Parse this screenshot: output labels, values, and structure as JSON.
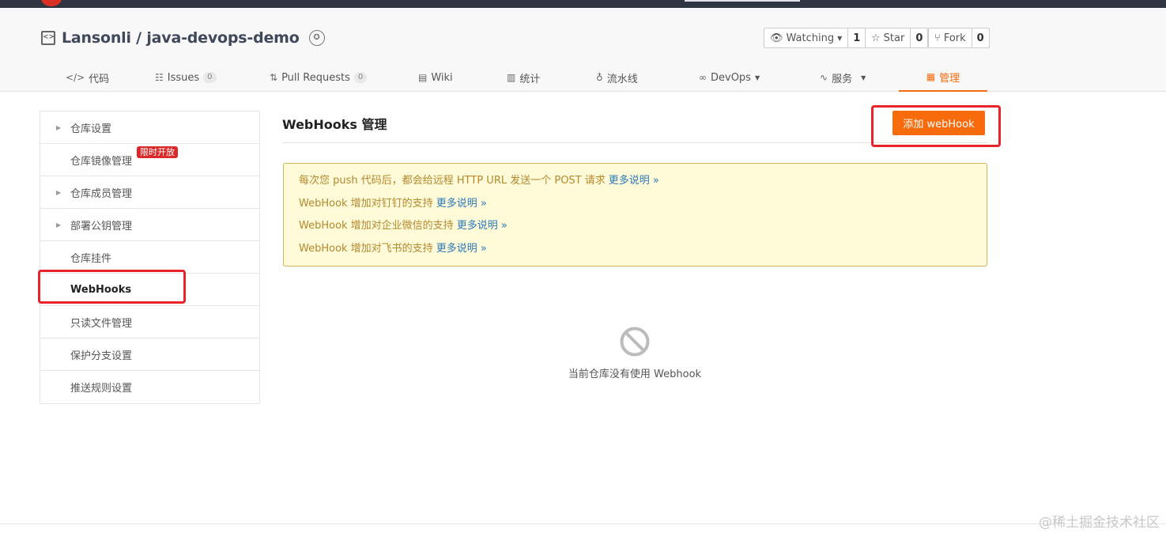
{
  "repo": {
    "owner_repo": "Lansonli / java-devops-demo"
  },
  "actions": [
    {
      "label": "Watching",
      "count": "1",
      "icon": "eye-icon"
    },
    {
      "label": "Star",
      "count": "0",
      "icon": "star-icon"
    },
    {
      "label": "Fork",
      "count": "0",
      "icon": "fork-icon"
    }
  ],
  "tabs": [
    {
      "label": "代码",
      "icon": "code-icon"
    },
    {
      "label": "Issues",
      "count": "0",
      "icon": "issues-icon"
    },
    {
      "label": "Pull Requests",
      "count": "0",
      "icon": "pull-request-icon"
    },
    {
      "label": "Wiki",
      "icon": "book-icon"
    },
    {
      "label": "统计",
      "icon": "bar-chart-icon"
    },
    {
      "label": "流水线",
      "icon": "pipeline-icon"
    },
    {
      "label": "DevOps",
      "icon": "infinity-icon"
    },
    {
      "label": "服务",
      "icon": "pulse-icon"
    },
    {
      "label": "管理",
      "icon": "document-icon"
    }
  ],
  "sidebar": {
    "items": [
      {
        "label": "仓库设置"
      },
      {
        "label": "仓库镜像管理",
        "tag": "限时开放"
      },
      {
        "label": "仓库成员管理"
      },
      {
        "label": "部署公钥管理"
      },
      {
        "label": "仓库挂件"
      },
      {
        "label": "WebHooks"
      },
      {
        "label": "只读文件管理"
      },
      {
        "label": "保护分支设置"
      },
      {
        "label": "推送规则设置"
      }
    ]
  },
  "main": {
    "title": "WebHooks 管理",
    "add_button": "添加 webHook",
    "notice": [
      {
        "text": "每次您 push 代码后，都会给远程 HTTP URL 发送一个 POST 请求",
        "more": "更多说明 »"
      },
      {
        "text": "WebHook 增加对钉钉的支持",
        "more": "更多说明 »"
      },
      {
        "text": "WebHook 增加对企业微信的支持",
        "more": "更多说明 »"
      },
      {
        "text": "WebHook 增加对飞书的支持",
        "more": "更多说明 »"
      }
    ],
    "empty_text": "当前仓库没有使用 Webhook"
  },
  "watermark": "@稀土掘金技术社区",
  "colors": {
    "accent": "#f76b0c",
    "annotation": "#e8232a",
    "notice_bg": "#fffad8",
    "notice_text": "#b5882d",
    "link": "#2b79b8"
  }
}
